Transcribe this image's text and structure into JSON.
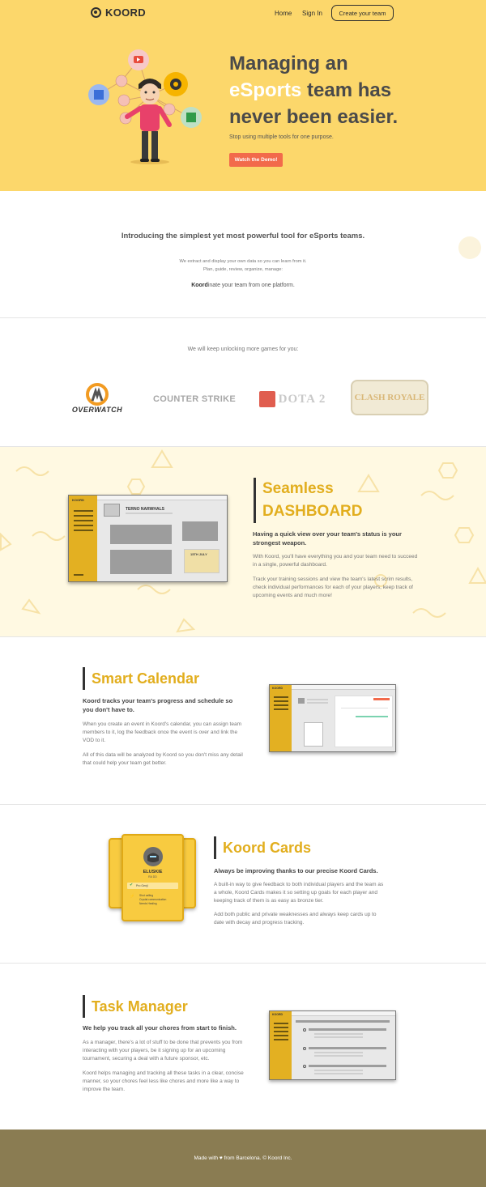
{
  "nav": {
    "brand": "KOORD",
    "home": "Home",
    "signin": "Sign In",
    "cta": "Create your team"
  },
  "hero": {
    "title_line1": "Managing an",
    "title_hl": "eSports",
    "title_line2": "team has",
    "title_line3": "never been easier.",
    "subtitle": "Stop using multiple tools for one purpose.",
    "button": "Watch the Demo!"
  },
  "intro": {
    "heading": "Introducing the simplest yet most powerful tool for eSports teams.",
    "line1": "We extract and display your own data so you can learn from it.",
    "line2": "Plan, guide, review, organize, manage:",
    "tag_bold": "Koord",
    "tag_rest": "inate your team from one platform."
  },
  "games": {
    "heading": "We will keep unlocking more games for you:",
    "items": [
      "OVERWATCH",
      "COUNTER STRIKE",
      "DOTA 2",
      "CLASH ROYALE"
    ]
  },
  "dashboard": {
    "title_line1": "Seamless",
    "title_line2": "DASHBOARD",
    "lead": "Having a quick view over your team's status is your strongest weapon.",
    "p1": "With Koord, you'll have everything you and your team need to succeed in a single, powerful dashboard.",
    "p2": "Track your training sessions and view the team's latest scrim results, check individual performances for each of your players, keep track of upcoming events and much more!",
    "mock_brand": "KOORD",
    "mock_team": "TERNO NARWHALS",
    "mock_date": "15TH JULY"
  },
  "calendar": {
    "title": "Smart Calendar",
    "lead": "Koord tracks your team's progress and schedule so you don't have to.",
    "p1": "When you create an event in Koord's calendar, you can assign team members to it, log the feedback once the event is over and link the VOD to it.",
    "p2": "All of this data will be analyzed by Koord so you don't miss any detail that could help your team get better.",
    "mock_brand": "KOORD"
  },
  "cards": {
    "title": "Koord Cards",
    "lead": "Always be improving thanks to our precise Koord Cards.",
    "p1": "A built-in way to give feedback to both individual players and the team as a whole, Koord Cards makes it so setting up goals for each player and keeping track of them is as easy as bronze tier.",
    "p2": "Add both public and private weaknesses and always keep cards up to date with decay and progress tracking.",
    "card_player": "ELUSKIE",
    "card_role": "RA DD",
    "card_item1": "Pro Genji",
    "card_item2": "Shot calling",
    "card_item3": "Crystal communication",
    "card_item4": "Needs Healing"
  },
  "tasks": {
    "title": "Task Manager",
    "lead": "We help you track all your chores from start to finish.",
    "p1": "As a manager, there's a lot of stuff to be done that prevents you from interacting with your players, be it signing up for an upcoming tournament, securing a deal with a future sponsor, etc.",
    "p2": "Koord helps managing and tracking all these tasks in a clear, concise manner, so your chores feel less like chores and more like a way to improve the team.",
    "mock_brand": "KOORD"
  },
  "footer": {
    "text": "Made with ♥ from Barcelona. © Koord Inc."
  },
  "colors": {
    "hero_bg": "#fcd76b",
    "accent": "#e2ae1e",
    "cta_red": "#f26a4b",
    "dash_bg": "#fff9e2",
    "footer_bg": "#8a7c52"
  }
}
